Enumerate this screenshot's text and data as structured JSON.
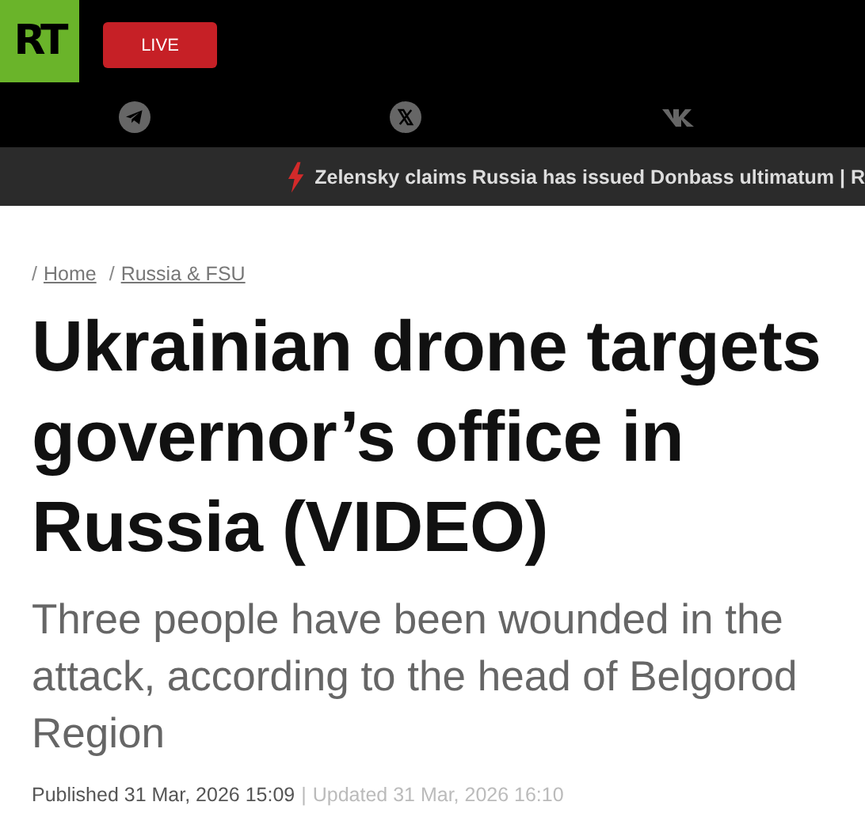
{
  "header": {
    "logo": "RT",
    "live_button": "LIVE"
  },
  "social_links": [
    {
      "kind": "telegram"
    },
    {
      "kind": "x"
    },
    {
      "kind": "vk"
    }
  ],
  "ticker": {
    "text": "Zelensky claims Russia has issued Donbass ultimatum | R"
  },
  "breadcrumbs": [
    {
      "separator": "/",
      "label": "Home"
    },
    {
      "separator": "/",
      "label": "Russia & FSU"
    }
  ],
  "article": {
    "title": "Ukrainian drone targets governor’s office in Russia (VIDEO)",
    "summary": "Three people have been wounded in the attack, according to the head of Belgorod Region",
    "published": "Published 31 Mar, 2026 15:09",
    "separator": "|",
    "updated": "Updated 31 Mar, 2026 16:10"
  }
}
